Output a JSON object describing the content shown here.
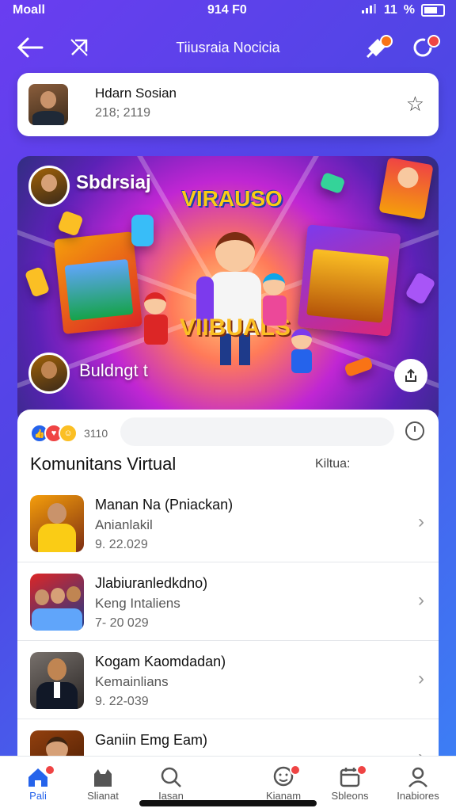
{
  "status": {
    "carrier": "Moall",
    "time": "914 F0",
    "signal": "11",
    "battery_text": "%"
  },
  "header": {
    "title": "Tiiusraia Nocicia",
    "back_icon": "arrow-left-icon",
    "crossed_icon": "no-link-icon"
  },
  "profile": {
    "name": "Hdarn Sosian",
    "sub": "218; 2119"
  },
  "banner": {
    "title": "Sbdrsiaj",
    "logo": "VIRAUSO",
    "word": "VIIBUALS",
    "subtitle": "Buldngt t"
  },
  "reactions": {
    "count": "3110"
  },
  "section": {
    "title": "Komunitans Virtual",
    "action": "Kiltua:"
  },
  "items": [
    {
      "title": "Manan Na (Pniackan)",
      "sub": "Anianlakil",
      "date": "9. 22.029"
    },
    {
      "title": "Jlabiuranledkdno)",
      "sub": "Keng Intaliens",
      "date": "7- 20 029"
    },
    {
      "title": "Kogam Kaomdadan)",
      "sub": "Kemainlians",
      "date": "9. 22-039"
    },
    {
      "title": "Ganiin  Emg Eam)",
      "sub": "",
      "date": ""
    }
  ],
  "tabs": [
    {
      "label": "Pali",
      "icon": "home-icon",
      "active": true
    },
    {
      "label": "Slianat",
      "icon": "cat-icon"
    },
    {
      "label": "Iasan",
      "icon": "search-icon"
    },
    {
      "label": "Kianam",
      "icon": "people-icon"
    },
    {
      "label": "Sbleons",
      "icon": "calendar-icon"
    },
    {
      "label": "Inabiores",
      "icon": "profile-icon"
    }
  ],
  "colors": {
    "accent": "#2563eb",
    "badge": "#ef4444"
  }
}
